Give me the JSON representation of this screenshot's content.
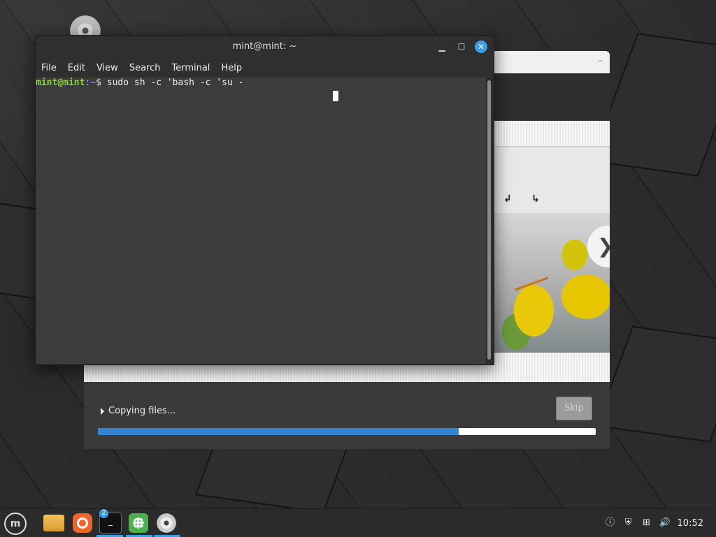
{
  "terminal": {
    "title": "mint@mint: ~",
    "menu": [
      "File",
      "Edit",
      "View",
      "Search",
      "Terminal",
      "Help"
    ],
    "prompt_user": "mint@mint",
    "prompt_path": ":~",
    "prompt_symbol": "$",
    "command": " sudo sh -c 'bash -c 'su -"
  },
  "installer": {
    "status_text": "Copying files...",
    "skip_label": "Skip",
    "progress_percent": 72.5
  },
  "taskbar": {
    "terminal_badge": "2",
    "terminal_glyph": "_",
    "clock": "10:52"
  },
  "icons": {
    "menu": "linux-mint-icon",
    "files": "folder-icon",
    "browser": "firefox-icon",
    "terminal": "terminal-icon",
    "apps": "software-manager-icon",
    "disc": "disc-icon"
  }
}
